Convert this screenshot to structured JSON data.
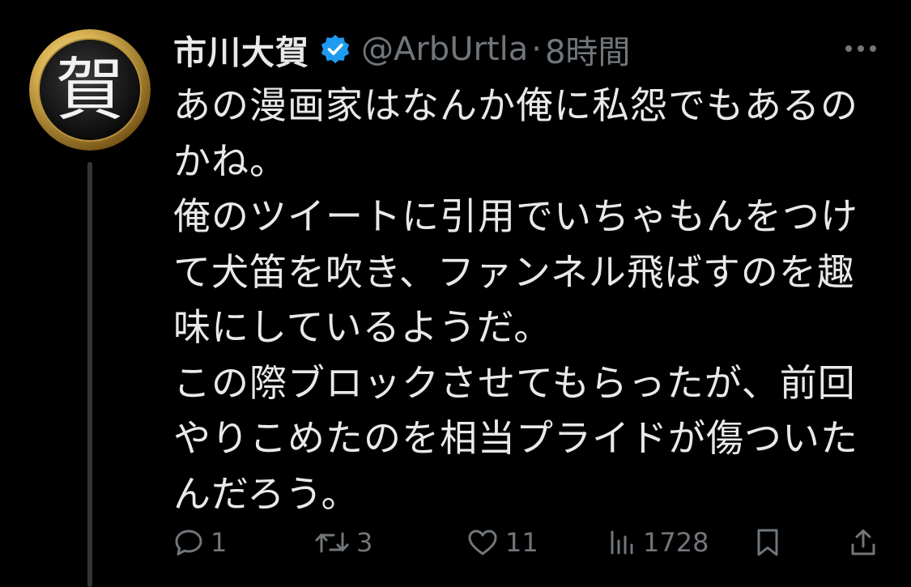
{
  "tweet": {
    "author": {
      "display_name": "市川大賀",
      "handle": "@ArbUrtla",
      "verified": true,
      "avatar_glyph": "賀"
    },
    "separator": "·",
    "timestamp": "8時間",
    "text_lines": [
      "あの漫画家はなんか俺に私怨でもあるの",
      "かね。",
      "俺のツイートに引用でいちゃもんをつけ",
      "て犬笛を吹き、ファンネル飛ばすのを趣",
      "味にしているようだ。",
      "この際ブロックさせてもらったが、前回",
      "やりこめたのを相当プライドが傷ついた",
      "んだろう。"
    ],
    "actions": {
      "reply_count": "1",
      "retweet_count": "3",
      "like_count": "11",
      "views_count": "1728"
    },
    "icons": {
      "more": "more-icon",
      "reply": "reply-icon",
      "retweet": "retweet-icon",
      "like": "like-icon",
      "views": "views-icon",
      "bookmark": "bookmark-icon",
      "share": "share-icon",
      "verified": "verified-badge-icon"
    },
    "colors": {
      "background": "#000000",
      "primary_text": "#e7e9ea",
      "secondary_text": "#71767b",
      "verified_blue": "#1d9bf0",
      "thread_line": "#333639"
    }
  }
}
